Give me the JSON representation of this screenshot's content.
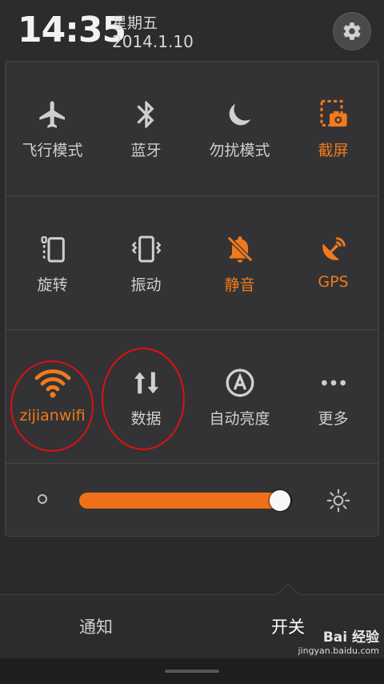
{
  "status": {
    "time": "14:35",
    "weekday": "星期五",
    "date": "2014.1.10"
  },
  "toggles": [
    {
      "label": "飞行模式",
      "icon": "airplane-icon",
      "on": false
    },
    {
      "label": "蓝牙",
      "icon": "bluetooth-icon",
      "on": false
    },
    {
      "label": "勿扰模式",
      "icon": "moon-icon",
      "on": false
    },
    {
      "label": "截屏",
      "icon": "screenshot-icon",
      "on": true
    },
    {
      "label": "旋转",
      "icon": "rotate-icon",
      "on": false
    },
    {
      "label": "振动",
      "icon": "vibrate-icon",
      "on": false
    },
    {
      "label": "静音",
      "icon": "mute-icon",
      "on": true
    },
    {
      "label": "GPS",
      "icon": "gps-icon",
      "on": true
    },
    {
      "label": "zijianwifi",
      "icon": "wifi-icon",
      "on": true
    },
    {
      "label": "数据",
      "icon": "data-icon",
      "on": false
    },
    {
      "label": "自动亮度",
      "icon": "auto-brightness-icon",
      "on": false
    },
    {
      "label": "更多",
      "icon": "more-icon",
      "on": false
    }
  ],
  "brightness": {
    "level": 0.99
  },
  "tabs": {
    "notifications": "通知",
    "toggles": "开关"
  },
  "watermark": {
    "brand": "Bai 经验",
    "url": "jingyan.baidu.com"
  },
  "colors": {
    "accent": "#f07a1c",
    "annotation": "#e01010",
    "inactive": "#cfcfcf"
  }
}
